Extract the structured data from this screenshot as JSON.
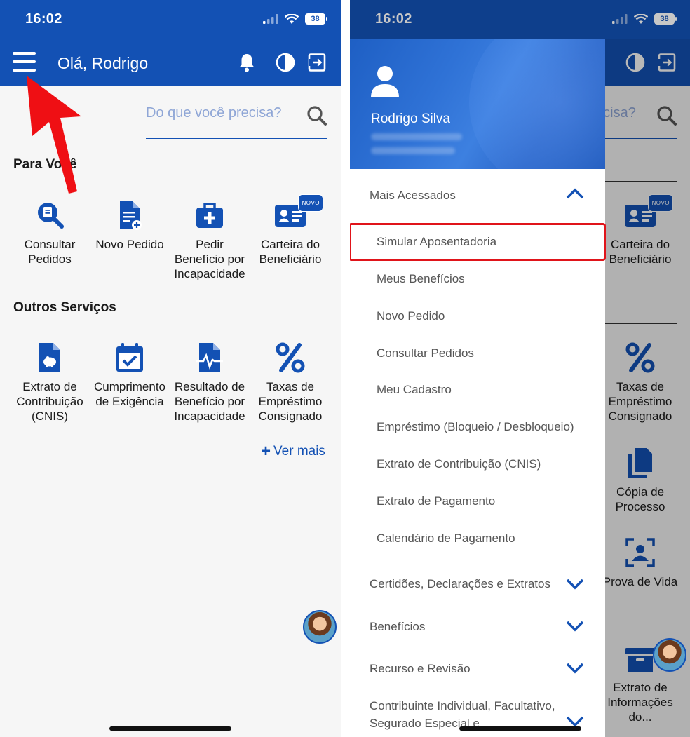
{
  "colors": {
    "primary": "#1351b4",
    "annotation": "#e0141a",
    "text": "#1b1b1b",
    "muted": "#555555"
  },
  "status_bar": {
    "time": "16:02",
    "battery": "38"
  },
  "left": {
    "greeting": "Olá, Rodrigo",
    "search": {
      "placeholder": "Do que você precisa?"
    },
    "section_para_voce": "Para Você",
    "tiles_para_voce": [
      {
        "label": "Consultar Pedidos",
        "icon": "search-document-icon"
      },
      {
        "label": "Novo Pedido",
        "icon": "new-document-icon"
      },
      {
        "label": "Pedir Benefício por Incapacidade",
        "icon": "medical-kit-icon"
      },
      {
        "label": "Carteira do Beneficiário",
        "icon": "id-card-icon",
        "badge": "NOVO"
      }
    ],
    "section_outros": "Outros Serviços",
    "tiles_outros": [
      {
        "label": "Extrato de Contribuição (CNIS)",
        "icon": "piggy-document-icon"
      },
      {
        "label": "Cumprimento de Exigência",
        "icon": "calendar-check-icon"
      },
      {
        "label": "Resultado de Benefício por Incapacidade",
        "icon": "heartbeat-document-icon"
      },
      {
        "label": "Taxas de Empréstimo Consignado",
        "icon": "percent-icon"
      }
    ],
    "ver_mais": "Ver mais"
  },
  "right": {
    "search_fragment": "ecisa?",
    "drawer": {
      "user_name": "Rodrigo Silva",
      "mais_acessados": "Mais Acessados",
      "items": [
        "Simular Aposentadoria",
        "Meus Benefícios",
        "Novo Pedido",
        "Consultar Pedidos",
        "Meu Cadastro",
        "Empréstimo (Bloqueio / Desbloqueio)",
        "Extrato de Contribuição (CNIS)",
        "Extrato de Pagamento",
        "Calendário de Pagamento"
      ],
      "categories": [
        "Certidões, Declarações e Extratos",
        "Benefícios",
        "Recurso e Revisão"
      ],
      "last_category": "Contribuinte Individual, Facultativo, Segurado Especial e"
    },
    "bg_tiles": [
      {
        "label": "Carteira do Beneficiário",
        "badge": "NOVO"
      },
      {
        "label": "Taxas de Empréstimo Consignado"
      },
      {
        "label": "Cópia de Processo"
      },
      {
        "label": "Prova de Vida"
      },
      {
        "label": "Extrato de Informações do..."
      }
    ]
  }
}
